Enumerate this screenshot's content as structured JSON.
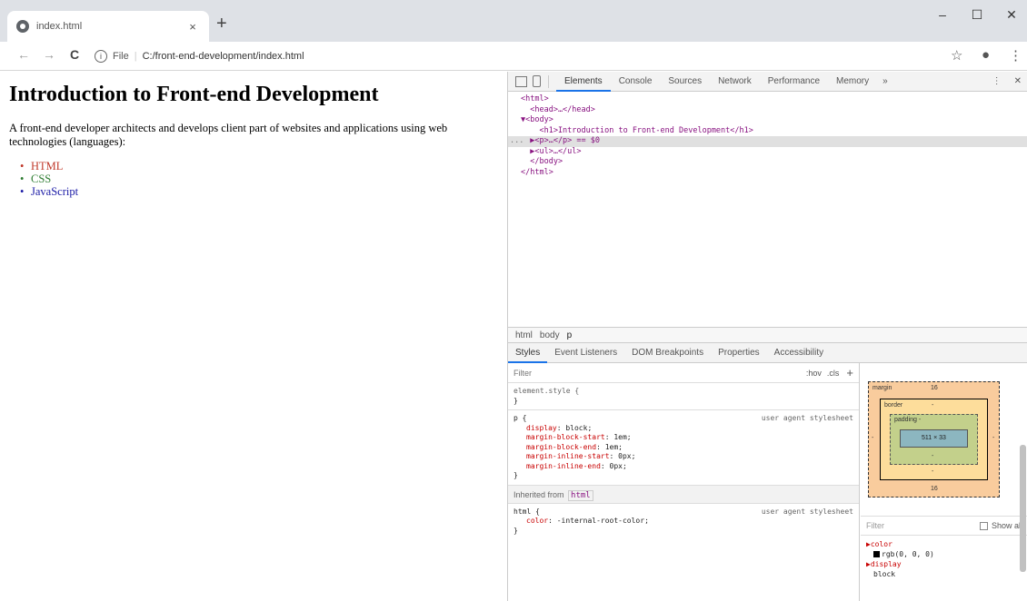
{
  "browser": {
    "tab_title": "index.html",
    "tab_close": "×",
    "new_tab": "+",
    "window_controls": {
      "minimize": "–",
      "maximize": "☐",
      "close": "✕"
    },
    "nav": {
      "back": "←",
      "forward": "→",
      "reload": "C"
    },
    "address": {
      "info": "i",
      "scheme": "File",
      "url": "C:/front-end-development/index.html"
    },
    "toolbar": {
      "star": "☆",
      "account": "●",
      "menu": "⋮"
    }
  },
  "page": {
    "heading": "Introduction to Front-end Development",
    "paragraph": "A front-end developer architects and develops client part of websites and applications using web technologies (languages):",
    "list": [
      "HTML",
      "CSS",
      "JavaScript"
    ],
    "colors": {
      "html": "#c0392b",
      "css": "#2e7d32",
      "js": "#1a1aa6"
    }
  },
  "devtools": {
    "tabs": [
      "Elements",
      "Console",
      "Sources",
      "Network",
      "Performance",
      "Memory"
    ],
    "active_tab": "Elements",
    "more_tabs": "»",
    "menu_icon": "⋮",
    "close_icon": "✕",
    "dom": [
      {
        "text": "<html>"
      },
      {
        "text": "  <head>…</head>"
      },
      {
        "text": "▼<body>"
      },
      {
        "text": "    <h1>Introduction to Front-end Development</h1>"
      },
      {
        "text": "  ▶<p>…</p> == $0",
        "selected": true,
        "gutter": "..."
      },
      {
        "text": "  ▶<ul>…</ul>"
      },
      {
        "text": "  </body>"
      },
      {
        "text": "</html>"
      }
    ],
    "breadcrumbs": [
      "html",
      "body",
      "p"
    ],
    "subtabs": [
      "Styles",
      "Event Listeners",
      "DOM Breakpoints",
      "Properties",
      "Accessibility"
    ],
    "active_subtab": "Styles",
    "styles": {
      "filter_placeholder": "Filter",
      "hov": ":hov",
      "cls": ".cls",
      "add": "+",
      "element_style": {
        "selector": "element.style {",
        "close": "}"
      },
      "p_rule": {
        "selector": "p {",
        "source": "user agent stylesheet",
        "decls": [
          {
            "prop": "display",
            "val": "block;"
          },
          {
            "prop": "margin-block-start",
            "val": "1em;"
          },
          {
            "prop": "margin-block-end",
            "val": "1em;"
          },
          {
            "prop": "margin-inline-start",
            "val": "0px;"
          },
          {
            "prop": "margin-inline-end",
            "val": "0px;"
          }
        ],
        "close": "}"
      },
      "inherited_label": "Inherited from",
      "inherited_tag": "html",
      "html_rule": {
        "selector": "html {",
        "source": "user agent stylesheet",
        "decls": [
          {
            "prop": "color",
            "val": "-internal-root-color;"
          }
        ],
        "close": "}"
      }
    },
    "boxmodel": {
      "margin_label": "margin",
      "margin_top": "16",
      "margin_bottom": "16",
      "margin_side": "-",
      "border_label": "border",
      "border_val": "-",
      "padding_label": "padding -",
      "padding_val": "-",
      "content": "511 × 33"
    },
    "computed": {
      "filter_placeholder": "Filter",
      "show_all": "Show all",
      "props": [
        {
          "prop": "▶color",
          "val": "rgb(0, 0, 0)",
          "swatch": true
        },
        {
          "prop": "▶display",
          "val": "block"
        }
      ]
    }
  }
}
